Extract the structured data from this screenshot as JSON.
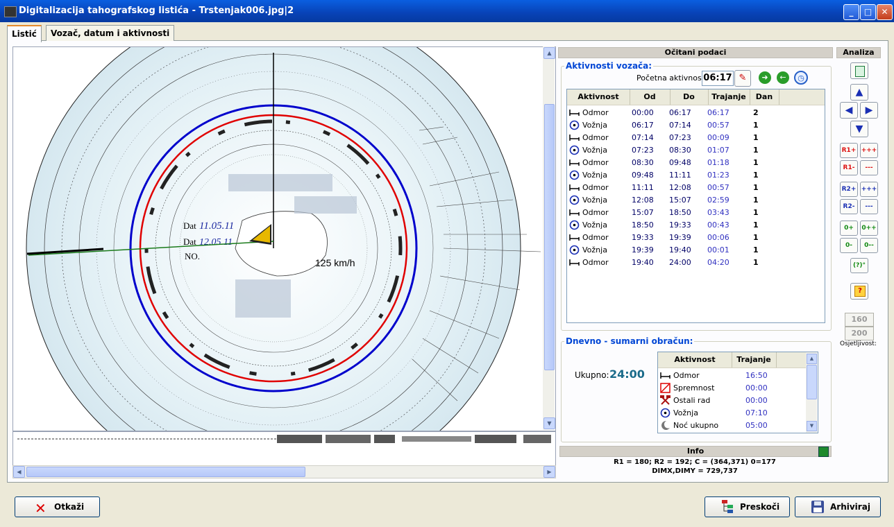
{
  "window": {
    "title": "Digitalizacija tahografskog listića - Trstenjak006.jpg|2"
  },
  "tabs": [
    {
      "label": "Listić"
    },
    {
      "label": "Vozač, datum i aktivnosti"
    }
  ],
  "image": {
    "labels": {
      "dat1": "Dat",
      "dat1_val": "11.05.11",
      "dat2": "Dat",
      "dat2_val": "12.05.11",
      "no": "NO.",
      "speed": "125 km/h"
    }
  },
  "right": {
    "header": "Očitani podaci",
    "activities": {
      "title": "Aktivnosti vozača:",
      "start_label": "Početna aktivnost:",
      "start_value": "06:17",
      "columns": [
        "Aktivnost",
        "Od",
        "Do",
        "Trajanje",
        "Dan"
      ],
      "rows": [
        {
          "type": "Odmor",
          "od": "00:00",
          "do": "06:17",
          "trajanje": "06:17",
          "dan": "2"
        },
        {
          "type": "Vožnja",
          "od": "06:17",
          "do": "07:14",
          "trajanje": "00:57",
          "dan": "1"
        },
        {
          "type": "Odmor",
          "od": "07:14",
          "do": "07:23",
          "trajanje": "00:09",
          "dan": "1"
        },
        {
          "type": "Vožnja",
          "od": "07:23",
          "do": "08:30",
          "trajanje": "01:07",
          "dan": "1"
        },
        {
          "type": "Odmor",
          "od": "08:30",
          "do": "09:48",
          "trajanje": "01:18",
          "dan": "1"
        },
        {
          "type": "Vožnja",
          "od": "09:48",
          "do": "11:11",
          "trajanje": "01:23",
          "dan": "1"
        },
        {
          "type": "Odmor",
          "od": "11:11",
          "do": "12:08",
          "trajanje": "00:57",
          "dan": "1"
        },
        {
          "type": "Vožnja",
          "od": "12:08",
          "do": "15:07",
          "trajanje": "02:59",
          "dan": "1"
        },
        {
          "type": "Odmor",
          "od": "15:07",
          "do": "18:50",
          "trajanje": "03:43",
          "dan": "1"
        },
        {
          "type": "Vožnja",
          "od": "18:50",
          "do": "19:33",
          "trajanje": "00:43",
          "dan": "1"
        },
        {
          "type": "Odmor",
          "od": "19:33",
          "do": "19:39",
          "trajanje": "00:06",
          "dan": "1"
        },
        {
          "type": "Vožnja",
          "od": "19:39",
          "do": "19:40",
          "trajanje": "00:01",
          "dan": "1"
        },
        {
          "type": "Odmor",
          "od": "19:40",
          "do": "24:00",
          "trajanje": "04:20",
          "dan": "1"
        }
      ]
    },
    "summary": {
      "title": "Dnevno - sumarni obračun:",
      "total_label": "Ukupno:",
      "total_value": "24:00",
      "columns": [
        "Aktivnost",
        "Trajanje"
      ],
      "rows": [
        {
          "type": "Odmor",
          "trajanje": "16:50"
        },
        {
          "type": "Spremnost",
          "trajanje": "00:00"
        },
        {
          "type": "Ostali rad",
          "trajanje": "00:00"
        },
        {
          "type": "Vožnja",
          "trajanje": "07:10"
        },
        {
          "type": "Noć ukupno",
          "trajanje": "05:00"
        }
      ]
    },
    "info": {
      "header": "Info",
      "line1": "R1 = 180; R2 = 192; C = (364,371)  0=177",
      "line2": "DIMX,DIMY = 729,737"
    }
  },
  "analiza": {
    "header": "Analiza",
    "r1_plus": "R1+",
    "r1_plusplus": "+++",
    "r1_minus": "R1-",
    "r1_minusminus": "---",
    "r2_plus": "R2+",
    "r2_plusplus": "+++",
    "r2_minus": "R2-",
    "r2_minusminus": "---",
    "o_plus": "0+",
    "o_plusplus": "0++",
    "o_minus": "0-",
    "o_minusminus": "0--",
    "q": "(?)°",
    "sens1": "160",
    "sens2": "200",
    "sens_label": "Osjetljivost:"
  },
  "buttons": {
    "cancel": "Otkaži",
    "skip": "Preskoči",
    "archive": "Arhiviraj"
  },
  "colors": {
    "accent": "#0046d5",
    "titlebar": "#0842b6"
  }
}
